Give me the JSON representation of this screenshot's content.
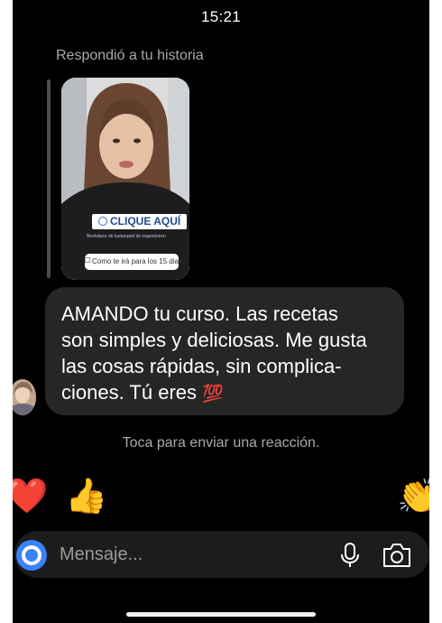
{
  "status_bar": {
    "time": "15:21"
  },
  "reply_context": {
    "label": "Respondió a tu historia"
  },
  "story": {
    "cta_label": "CLIQUE AQUÍ",
    "caption": "Bextvbeur de tuetaoped do regeretvecn",
    "question": "Como te irá para los 15 dias?"
  },
  "message": {
    "lines": [
      "AMANDO tu curso. Las recetas",
      "son simples y deliciosas. Me gusta",
      "las cosas rápidas, sin complica-",
      "ciones. Tú eres"
    ],
    "emoji": "💯",
    "emoji_name": "hundred-points-emoji"
  },
  "reaction_hint": "Toca para enviar una reacción.",
  "reactions": [
    {
      "name": "red-heart",
      "glyph": "❤️"
    },
    {
      "name": "thumbs-up",
      "glyph": "👍"
    },
    {
      "name": "crying-face",
      "glyph": "😢"
    },
    {
      "name": "heart-eyes",
      "glyph": "😍"
    },
    {
      "name": "surprised-face",
      "glyph": "😮"
    },
    {
      "name": "tears-of-joy",
      "glyph": "😂"
    },
    {
      "name": "clapping-hands",
      "glyph": "👏"
    }
  ],
  "composer": {
    "placeholder": "Mensaje...",
    "accent_color": "#3b82f6",
    "icons": [
      "camera-icon",
      "microphone-icon",
      "photo-icon"
    ]
  }
}
